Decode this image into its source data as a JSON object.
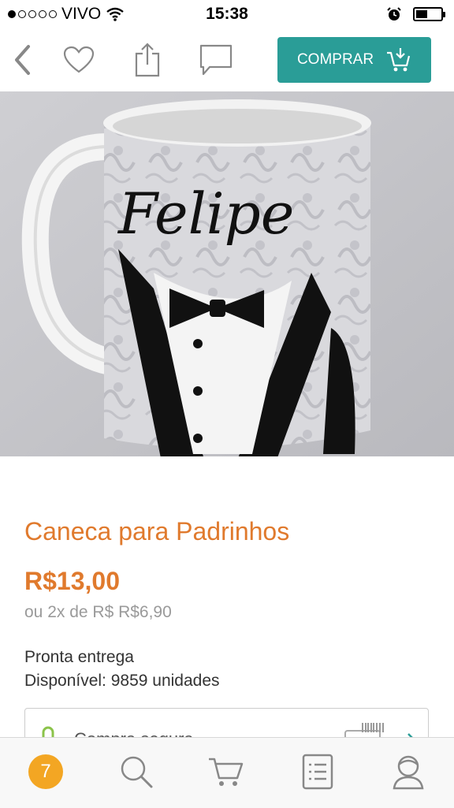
{
  "status_bar": {
    "carrier": "VIVO",
    "time": "15:38",
    "signal_bars_filled": 1,
    "signal_bars_total": 5,
    "battery_level": 0.45
  },
  "toolbar": {
    "buy_label": "COMPRAR",
    "icons": [
      "back-chevron-icon",
      "heart-icon",
      "share-icon",
      "chat-icon",
      "cart-download-icon"
    ]
  },
  "product": {
    "image_text": "Felipe",
    "title": "Caneca para Padrinhos",
    "price": "R$13,00",
    "installments": "ou 2x de R$ R$6,90",
    "availability": "Pronta entrega",
    "stock": "Disponível: 9859 unidades"
  },
  "secure_purchase": {
    "label": "Compra segura"
  },
  "tabbar": {
    "badge_count": "7",
    "icons": [
      "home-badge",
      "search-icon",
      "cart-icon",
      "list-icon",
      "profile-icon"
    ]
  },
  "colors": {
    "accent_teal": "#2a9d97",
    "price_orange": "#e07a2d",
    "badge_orange": "#f3a623"
  }
}
